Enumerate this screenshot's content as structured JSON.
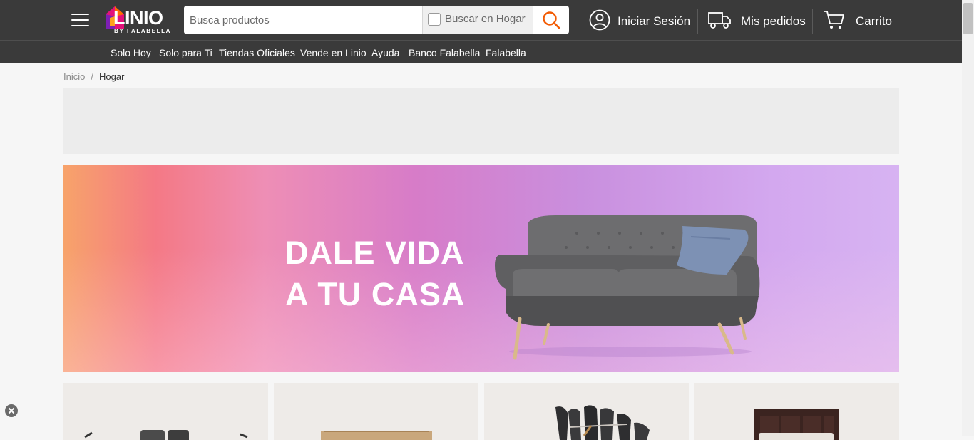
{
  "brand": {
    "name": "LINIO",
    "subtitle": "BY FALABELLA"
  },
  "search": {
    "placeholder": "Busca productos",
    "value": "",
    "scope_label": "Buscar en Hogar",
    "scope_checked": false
  },
  "header": {
    "login_label": "Iniciar Sesión",
    "orders_label": "Mis pedidos",
    "cart_label": "Carrito"
  },
  "nav": {
    "items": [
      {
        "label": "Solo Hoy"
      },
      {
        "label": "Solo para Ti"
      },
      {
        "label": "Tiendas Oficiales"
      },
      {
        "label": "Vende en Linio"
      },
      {
        "label": "Ayuda"
      },
      {
        "label": "Banco Falabella"
      },
      {
        "label": "Falabella"
      }
    ]
  },
  "breadcrumb": {
    "items": [
      {
        "label": "Inicio"
      },
      {
        "label": "Hogar"
      }
    ],
    "separator": "/"
  },
  "hero": {
    "line1": "DALE VIDA",
    "line2": "A TU CASA"
  },
  "colors": {
    "header_bg": "#3a3a3a",
    "accent": "#f25c05",
    "logo_orange": "#ff6b00",
    "logo_pink": "#e3127a",
    "logo_purple": "#7d1fb3",
    "page_bg": "#f6f6f6"
  }
}
